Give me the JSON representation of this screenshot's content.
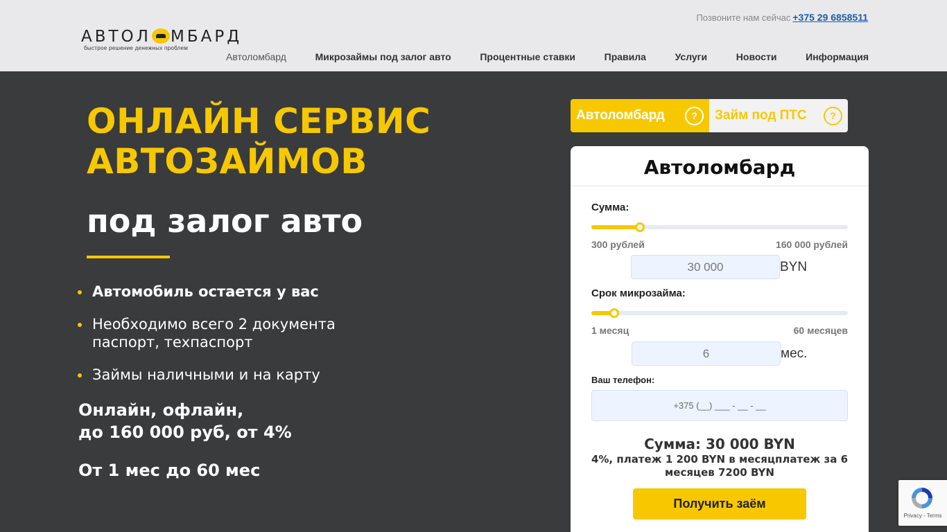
{
  "header": {
    "logo_text_left": "АВТОЛ",
    "logo_text_right": "МБАРД",
    "logo_tagline": "быстрое решение денежных проблем",
    "call_label": "Позвоните нам сейчас",
    "phone": "+375 29 6858511"
  },
  "nav": {
    "items": [
      {
        "label": "Автоломбард"
      },
      {
        "label": "Микрозаймы под залог авто"
      },
      {
        "label": "Процентные ставки"
      },
      {
        "label": "Правила"
      },
      {
        "label": "Услуги"
      },
      {
        "label": "Новости"
      },
      {
        "label": "Информация"
      }
    ]
  },
  "hero": {
    "title_line1": "ОНЛАЙН СЕРВИС",
    "title_line2": "АВТОЗАЙМОВ",
    "subtitle": "под залог авто",
    "bullets": [
      {
        "text": "Автомобиль остается у вас"
      },
      {
        "text_line1": "Необходимо всего 2 документа",
        "text_line2": "паспорт, техпаспорт"
      },
      {
        "text": "Займы наличными и на карту"
      }
    ],
    "offer_line1": "Онлайн, офлайн,",
    "offer_line2": "до 160 000 руб, от 4%",
    "offer_line3": "От 1 мес до 60 мес"
  },
  "tabs": [
    {
      "label": "Автоломбард",
      "help": "?",
      "active": true
    },
    {
      "label": "Займ под ПТС",
      "help": "?",
      "active": false
    }
  ],
  "calculator": {
    "title": "Автоломбард",
    "amount": {
      "label": "Сумма:",
      "min_label": "300 рублей",
      "max_label": "160 000 рублей",
      "value": "30 000",
      "unit": "BYN",
      "slider_fraction": 0.19
    },
    "term": {
      "label": "Срок микрозайма:",
      "min_label": "1 месяц",
      "max_label": "60 месяцев",
      "value": "6",
      "unit": "мес.",
      "slider_fraction": 0.09
    },
    "phone": {
      "label": "Ваш телефон:",
      "placeholder": "+375 (__) ___ - __ - __"
    },
    "summary": "Сумма: 30 000 BYN",
    "details_line1": "4%, платеж 1 200 BYN в месяцплатеж за 6",
    "details_line2": "месяцев 7200 BYN",
    "submit_label": "Получить заём"
  },
  "recaptcha": {
    "links": "Privacy - Terms"
  },
  "colors": {
    "accent": "#f7c800",
    "hero_bg": "#3a3b3c",
    "header_bg": "#e9e9ec",
    "link": "#1a5ea8"
  }
}
